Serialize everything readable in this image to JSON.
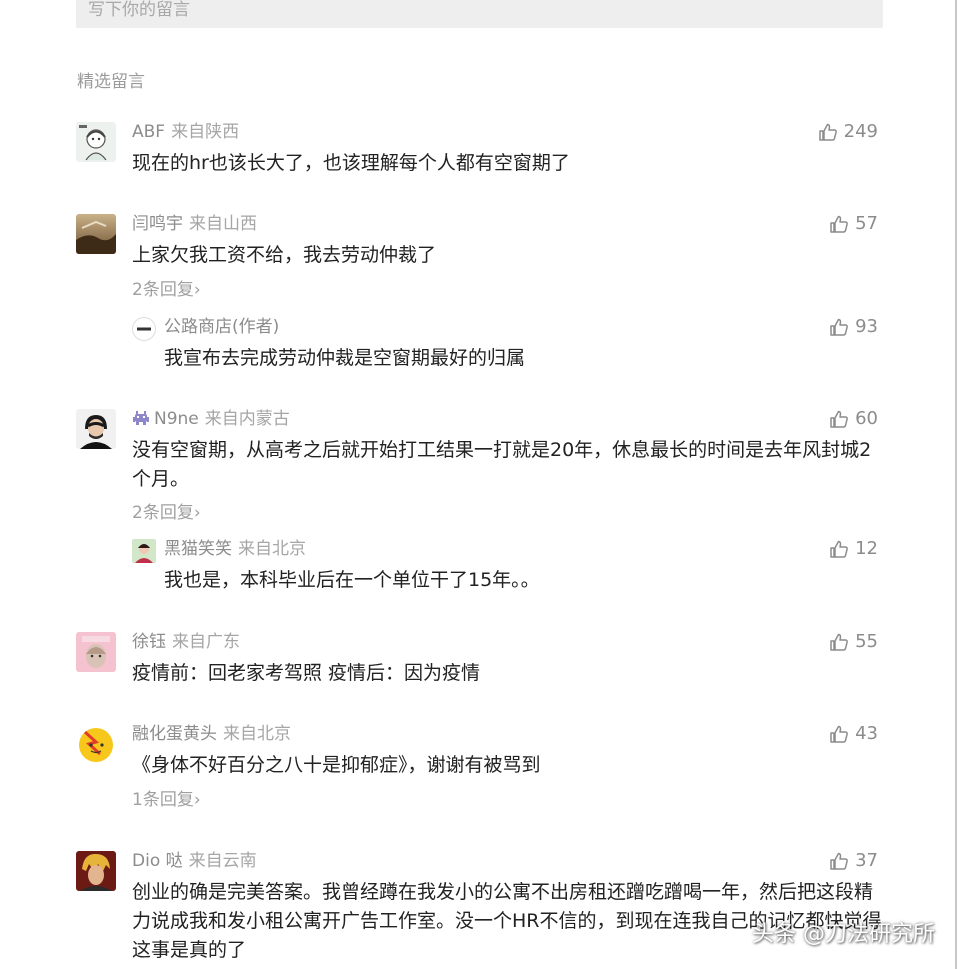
{
  "input": {
    "placeholder_text": "写下你的留言"
  },
  "section_title": "精选留言",
  "comments": [
    {
      "name": "ABF",
      "location": "来自陕西",
      "likes": "249",
      "content": "现在的hr也该长大了，也该理解每个人都有空窗期了"
    },
    {
      "name": "闫鸣宇",
      "location": "来自山西",
      "likes": "57",
      "content": "上家欠我工资不给，我去劳动仲裁了",
      "more_replies": "2条回复",
      "reply": {
        "name": "公路商店(作者)",
        "likes": "93",
        "content": "我宣布去完成劳动仲裁是空窗期最好的归属",
        "avatar_text": "公路商店"
      }
    },
    {
      "name": "N9ne",
      "location": "来自内蒙古",
      "likes": "60",
      "content": "没有空窗期，从高考之后就开始打工结果一打就是20年，休息最长的时间是去年风封城2个月。",
      "more_replies": "2条回复",
      "reply": {
        "name": "黑猫笑笑",
        "location": "来自北京",
        "likes": "12",
        "content": "我也是，本科毕业后在一个单位干了15年。。"
      }
    },
    {
      "name": "徐钰",
      "location": "来自广东",
      "likes": "55",
      "content": "疫情前：回老家考驾照 疫情后：因为疫情"
    },
    {
      "name": "融化蛋黄头",
      "location": "来自北京",
      "likes": "43",
      "content": "《身体不好百分之八十是抑郁症》，谢谢有被骂到",
      "more_replies": "1条回复"
    },
    {
      "name": "Dio 哒",
      "location": "来自云南",
      "likes": "37",
      "content": "创业的确是完美答案。我曾经蹲在我发小的公寓不出房租还蹭吃蹭喝一年，然后把这段精力说成我和发小租公寓开广告工作室。没一个HR不信的，到现在连我自己的记忆都快觉得这事是真的了"
    }
  ],
  "watermark": "头条 @刀法研究所",
  "colors": {
    "text": "#222222",
    "meta": "#8c8c8c",
    "location": "#a6a6a6",
    "input_bg": "#eeeeee"
  }
}
